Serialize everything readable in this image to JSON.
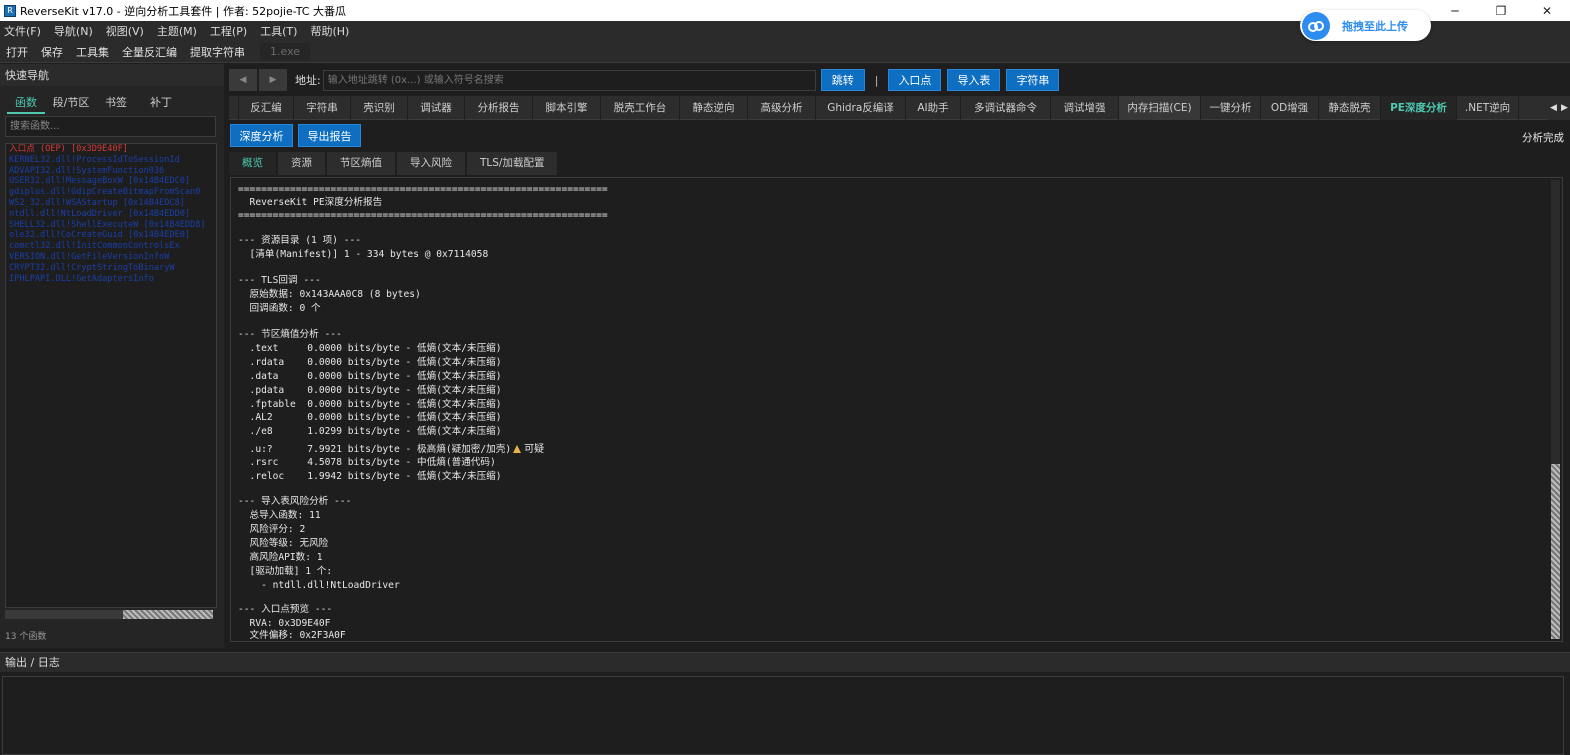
{
  "window": {
    "title": "ReverseKit v17.0 - 逆向分析工具套件 | 作者: 52pojie-TC 大番瓜",
    "controls": [
      "─",
      "❐",
      "✕"
    ]
  },
  "menu": [
    "文件(F)",
    "导航(N)",
    "视图(V)",
    "主题(M)",
    "工程(P)",
    "工具(T)",
    "帮助(H)"
  ],
  "quickbar": {
    "items": [
      "打开",
      "保存",
      "工具集",
      "全量反汇编",
      "提取字符串"
    ],
    "file_tab": "1.exe"
  },
  "upload": {
    "label": "拖拽至此上传"
  },
  "left_panel": {
    "title": "快速导航",
    "tabs": [
      "函数",
      "段/节区",
      "书签",
      "补丁"
    ],
    "search_placeholder": "搜索函数...",
    "functions": [
      "入口点 (OEP) [0x3D9E40F]",
      "KERNEL32.dll!ProcessIdToSessionId",
      "ADVAPI32.dll!SystemFunction036",
      "USER32.dll!MessageBoxW  [0x14B4EDC0]",
      "gdiplus.dll!GdipCreateBitmapFromScan0",
      "WS2_32.dll!WSAStartup  [0x14B4EDC8]",
      "ntdll.dll!NtLoadDriver  [0x14B4EDD0]",
      "SHELL32.dll!ShellExecuteW  [0x14B4EDD8]",
      "ole32.dll!CoCreateGuid  [0x14B4EDE0]",
      "comctl32.dll!InitCommonControlsEx",
      "VERSION.dll!GetFileVersionInfoW",
      "CRYPT32.dll!CryptStringToBinaryW",
      "IPHLPAPI.DLL!GetAdaptersInfo"
    ],
    "count": "13 个函数"
  },
  "address_bar": {
    "label": "地址:",
    "placeholder": "输入地址跳转 (0x...) 或输入符号名搜索",
    "buttons": [
      "跳转",
      "入口点",
      "导入表",
      "字符串"
    ],
    "separator": "|"
  },
  "tabs": [
    "反汇编",
    "字符串",
    "壳识别",
    "调试器",
    "分析报告",
    "脚本引擎",
    "脱壳工作台",
    "静态逆向",
    "高级分析",
    "Ghidra反编译",
    "AI助手",
    "多调试器命令",
    "调试增强",
    "内存扫描(CE)",
    "一键分析",
    "OD增强",
    "静态脱壳",
    "PE深度分析",
    ".NET逆向"
  ],
  "active_tab": "PE深度分析",
  "actions": {
    "deep": "深度分析",
    "export": "导出报告",
    "status": "分析完成"
  },
  "sub_tabs": [
    "概览",
    "资源",
    "节区熵值",
    "导入风险",
    "TLS/加载配置"
  ],
  "report": [
    "================================================================",
    "  ReverseKit PE深度分析报告",
    "================================================================",
    "",
    "--- 资源目录 (1 项) ---",
    "  [清单(Manifest)] 1 - 334 bytes @ 0x7114058",
    "",
    "--- TLS回调 ---",
    "  原始数据: 0x143AAA0C8 (8 bytes)",
    "  回调函数: 0 个",
    "",
    "--- 节区熵值分析 ---",
    "  .text     0.0000 bits/byte - 低熵(文本/未压缩)",
    "  .rdata    0.0000 bits/byte - 低熵(文本/未压缩)",
    "  .data     0.0000 bits/byte - 低熵(文本/未压缩)",
    "  .pdata    0.0000 bits/byte - 低熵(文本/未压缩)",
    "  .fptable  0.0000 bits/byte - 低熵(文本/未压缩)",
    "  .AL2      0.0000 bits/byte - 低熵(文本/未压缩)",
    "  ./e8      1.0299 bits/byte - 低熵(文本/未压缩)",
    "  .u:?      7.9921 bits/byte - 极高熵(疑加密/加壳)",
    "  .rsrc     4.5078 bits/byte - 中低熵(普通代码)",
    "  .reloc    1.9942 bits/byte - 低熵(文本/未压缩)",
    "",
    "--- 导入表风险分析 ---",
    "  总导入函数: 11",
    "  风险评分: 2",
    "  风险等级: 无风险",
    "  高风险API数: 1",
    "  [驱动加载] 1 个:",
    "    - ntdll.dll!NtLoadDriver",
    "",
    "--- 入口点预览 ---",
    "  RVA: 0x3D9E40F",
    "  文件偏移: 0x2F3A0F"
  ],
  "suspicious_label": "可疑",
  "output": {
    "title": "输出 / 日志"
  }
}
